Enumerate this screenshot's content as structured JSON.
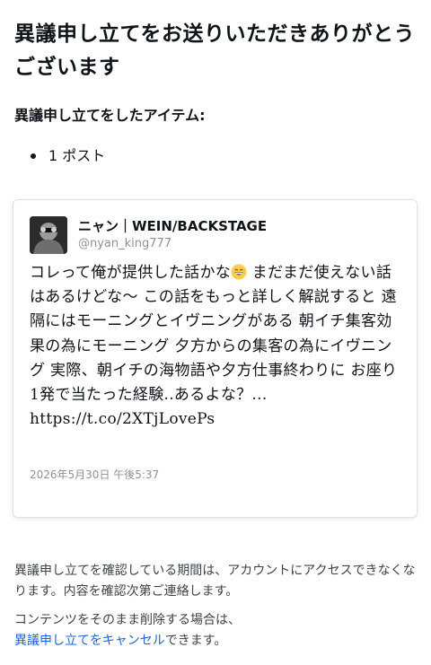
{
  "title": "異議申し立てをお送りいただきありがとうございます",
  "items_heading": "異議申し立てをしたアイテム:",
  "items": [
    "1 ポスト"
  ],
  "tweet": {
    "author_name": "ニャン｜WEIN/BACKSTAGE",
    "author_handle": "@nyan_king777",
    "text_before_emoji": "コレって俺が提供した話かな",
    "emoji": "grinning-face-with-smiling-eyes",
    "text_after_emoji": " まだまだ使えない話はあるけどな〜 この話をもっと詳しく解説すると 遠隔にはモーニングとイヴニングがある 朝イチ集客効果の為にモーニング 夕方からの集客の為にイヴニング 実際、朝イチの海物語や夕方仕事終わりに お座り1発で当たった経験..あるよな？...",
    "link": "https://t.co/2XTjLovePs",
    "date": "2026年5月30日 午後5:37"
  },
  "info_paragraph": "異議申し立てを確認している期間は、アカウントにアクセスできなくなります。内容を確認次第ご連絡します。",
  "cancel_prefix": "コンテンツをそのまま削除する場合は、",
  "cancel_link_label": "異議申し立てをキャンセル",
  "cancel_suffix": "できます。",
  "colors": {
    "text": "#0f1419",
    "muted": "#8a949e",
    "link": "#1d63d6",
    "card_border": "#dfe3e6"
  }
}
